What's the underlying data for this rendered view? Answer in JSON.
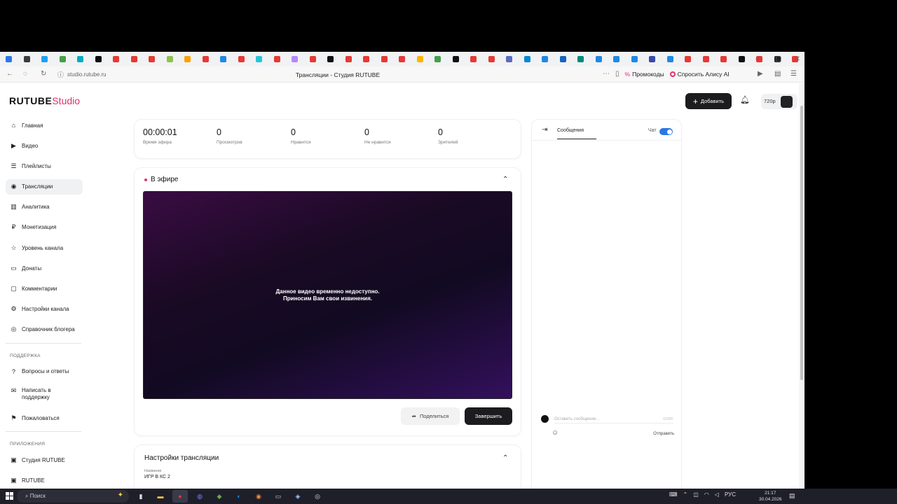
{
  "browser": {
    "tab_colors": [
      "#2b78e4",
      "#3c3c3c",
      "#1da1f2",
      "#43a047",
      "#00acc1",
      "#0b0b0b",
      "#e53935",
      "#e53935",
      "#e53935",
      "#8bc34a",
      "#ffa000",
      "#e53935",
      "#1e88e5",
      "#e53935",
      "#26c6da",
      "#e53935",
      "#b388ff",
      "#e53935",
      "#111111",
      "#e53935",
      "#e53935",
      "#e53935",
      "#e53935",
      "#ffb300",
      "#43a047",
      "#111111",
      "#e53935",
      "#e53935",
      "#5c6bc0",
      "#0288d1",
      "#1e88e5",
      "#1565c0",
      "#00897b",
      "#1e88e5",
      "#1e88e5",
      "#1e88e5",
      "#3949ab",
      "#1e88e5",
      "#e53935",
      "#e53935",
      "#e53935",
      "#111111",
      "#e53935",
      "#212121",
      "#e53935",
      "#e53935",
      "#e53935"
    ],
    "url": "studio.rutube.ru",
    "page_title": "Трансляции - Студия RUTUBE",
    "promo_label": "Промокоды",
    "ask_label": "Спросить Алису AI"
  },
  "logo": {
    "main": "RUTUBE",
    "sub": "Studio"
  },
  "sidebar": {
    "items": [
      {
        "label": "Главная",
        "icon": "⌂"
      },
      {
        "label": "Видео",
        "icon": "▶"
      },
      {
        "label": "Плейлисты",
        "icon": "☰"
      },
      {
        "label": "Трансляции",
        "icon": "◉"
      },
      {
        "label": "Аналитика",
        "icon": "▥"
      },
      {
        "label": "Монетизация",
        "icon": "₽"
      },
      {
        "label": "Уровень канала",
        "icon": "☆"
      },
      {
        "label": "Донаты",
        "icon": "▭"
      },
      {
        "label": "Комментарии",
        "icon": "▢"
      },
      {
        "label": "Настройки канала",
        "icon": "⚙"
      },
      {
        "label": "Справочник блогера",
        "icon": "◎"
      }
    ],
    "support_title": "ПОДДЕРЖКА",
    "support_items": [
      {
        "label": "Вопросы и ответы",
        "icon": "?"
      },
      {
        "label": "Написать в поддержку",
        "icon": "✉"
      },
      {
        "label": "Пожаловаться",
        "icon": "⚑"
      }
    ],
    "apps_title": "ПРИЛОЖЕНИЯ",
    "apps_items": [
      {
        "label": "Студия RUTUBE",
        "icon": "▣"
      },
      {
        "label": "RUTUBE",
        "icon": "▣"
      }
    ]
  },
  "stats": [
    {
      "value": "00:00:01",
      "label": "Время эфира"
    },
    {
      "value": "0",
      "label": "Просмотров"
    },
    {
      "value": "0",
      "label": "Нравится"
    },
    {
      "value": "0",
      "label": "Не нравится"
    },
    {
      "value": "0",
      "label": "Зрителей"
    }
  ],
  "live": {
    "title": "В эфире",
    "msg_line1": "Данное видео временно недоступно.",
    "msg_line2": "Приносим Вам свои извинения.",
    "share_label": "Поделиться",
    "end_label": "Завершить"
  },
  "settings": {
    "title": "Настройки трансляции",
    "name_label": "Название",
    "name_value": "ИГР В КС 2"
  },
  "chat": {
    "tab_label": "Сообщения",
    "chat_label": "Чат",
    "input_placeholder": "Оставить сообщение...",
    "counter": "0/200",
    "send_label": "Отправить"
  },
  "topbar": {
    "add_label": "Добавить",
    "quality": "720p"
  },
  "taskbar": {
    "search_label": "Поиск",
    "lang": "РУС",
    "time": "21:17",
    "date": "30.04.2026"
  }
}
